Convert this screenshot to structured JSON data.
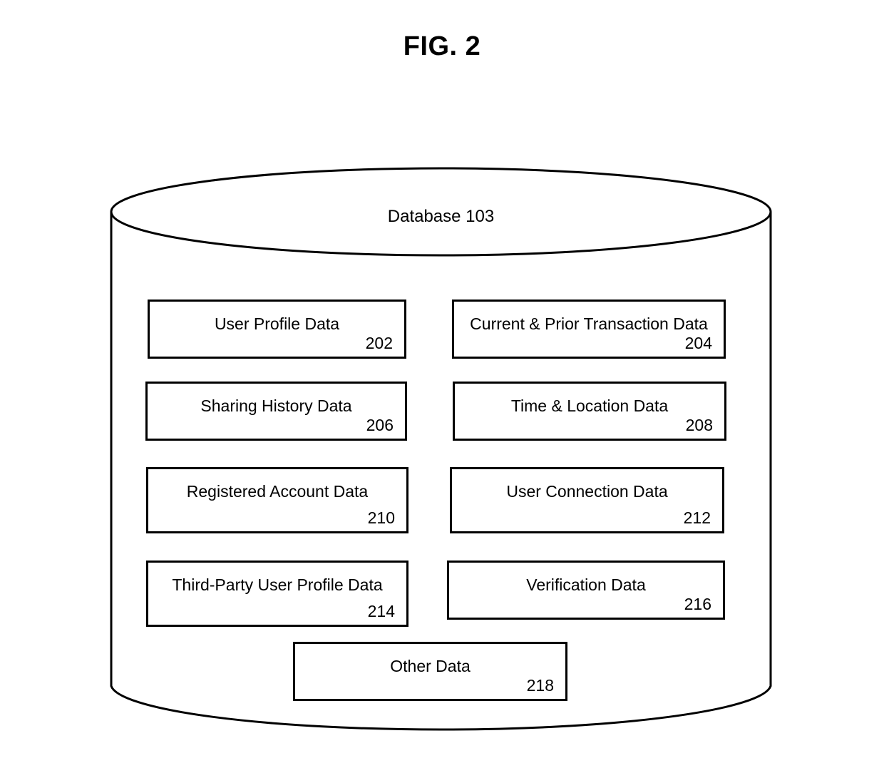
{
  "figure": {
    "title": "FIG. 2"
  },
  "database": {
    "label": "Database 103",
    "shape": "cylinder"
  },
  "boxes": [
    {
      "id": "202",
      "label": "User Profile Data",
      "ref": "202"
    },
    {
      "id": "204",
      "label": "Current & Prior Transaction Data",
      "ref": "204"
    },
    {
      "id": "206",
      "label": "Sharing History Data",
      "ref": "206"
    },
    {
      "id": "208",
      "label": "Time & Location Data",
      "ref": "208"
    },
    {
      "id": "210",
      "label": "Registered Account Data",
      "ref": "210"
    },
    {
      "id": "212",
      "label": "User Connection Data",
      "ref": "212"
    },
    {
      "id": "214",
      "label": "Third-Party User Profile Data",
      "ref": "214"
    },
    {
      "id": "216",
      "label": "Verification Data",
      "ref": "216"
    },
    {
      "id": "218",
      "label": "Other Data",
      "ref": "218"
    }
  ],
  "colors": {
    "stroke": "#000000",
    "background": "#ffffff",
    "text": "#000000"
  }
}
